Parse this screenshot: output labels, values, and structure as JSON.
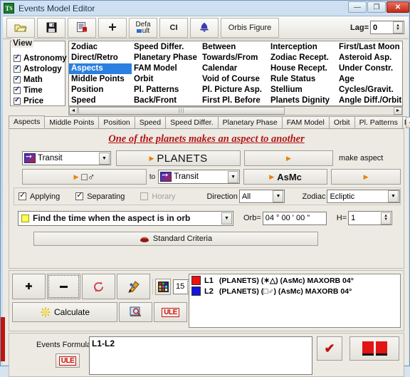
{
  "window": {
    "title": "Events Model Editor",
    "icon": "timing-solution-icon",
    "minimize": "—",
    "maximize": "❐",
    "close": "✕"
  },
  "toolbar": {
    "open": "folder-open-icon",
    "save": "floppy-save-icon",
    "save_as": "save-report-icon",
    "move": "move-cross-icon",
    "default_line1": "Defa",
    "default_line2": "ult",
    "ci": "CI",
    "bell": "bell-icon",
    "orbis_figure": "Orbis Figure",
    "lag_label": "Lag=",
    "lag_value": "0"
  },
  "view_panel": {
    "title": "View",
    "checkboxes": [
      {
        "label": "Astronomy",
        "checked": true
      },
      {
        "label": "Astrology",
        "checked": true
      },
      {
        "label": "Math",
        "checked": true
      },
      {
        "label": "Time",
        "checked": true
      },
      {
        "label": "Price",
        "checked": true
      }
    ],
    "columns": [
      {
        "items": [
          {
            "label": "Zodiac",
            "selected": false
          },
          {
            "label": "Direct/Retro",
            "selected": false
          },
          {
            "label": "Aspects",
            "selected": true
          },
          {
            "label": "Middle Points",
            "selected": false
          },
          {
            "label": "Position",
            "selected": false
          },
          {
            "label": "Speed",
            "selected": false
          }
        ]
      },
      {
        "items": [
          {
            "label": "Speed Differ.",
            "selected": false
          },
          {
            "label": "Planetary Phase",
            "selected": false
          },
          {
            "label": "FAM Model",
            "selected": false
          },
          {
            "label": "Orbit",
            "selected": false
          },
          {
            "label": "Pl. Patterns",
            "selected": false
          },
          {
            "label": "Back/Front",
            "selected": false
          }
        ]
      },
      {
        "items": [
          {
            "label": "Between",
            "selected": false
          },
          {
            "label": "Towards/From",
            "selected": false
          },
          {
            "label": "Calendar",
            "selected": false
          },
          {
            "label": "Void of Course",
            "selected": false
          },
          {
            "label": "Pl. Picture Asp.",
            "selected": false
          },
          {
            "label": "First Pl. Before",
            "selected": false
          }
        ]
      },
      {
        "items": [
          {
            "label": "Interception",
            "selected": false
          },
          {
            "label": "Zodiac Recept.",
            "selected": false
          },
          {
            "label": "House Recept.",
            "selected": false
          },
          {
            "label": "Rule Status",
            "selected": false
          },
          {
            "label": "Stellium",
            "selected": false
          },
          {
            "label": "Planets Dignity",
            "selected": false
          }
        ]
      },
      {
        "items": [
          {
            "label": "First/Last Moon A.N.",
            "selected": false
          },
          {
            "label": "Asteroid Asp.",
            "selected": false
          },
          {
            "label": "Under Constr.",
            "selected": false
          },
          {
            "label": "Age",
            "selected": false
          },
          {
            "label": "Cycles/Gravit.",
            "selected": false
          },
          {
            "label": "Angle Diff./Orbit",
            "selected": false
          }
        ]
      }
    ],
    "scroll_left": "◄",
    "scroll_right": "►",
    "thumb_grip": "|||"
  },
  "tabs": {
    "items": [
      {
        "label": "Aspects",
        "active": true
      },
      {
        "label": "Middle Points",
        "active": false
      },
      {
        "label": "Position",
        "active": false
      },
      {
        "label": "Speed",
        "active": false
      },
      {
        "label": "Speed Differ.",
        "active": false
      },
      {
        "label": "Planetary Phase",
        "active": false
      },
      {
        "label": "FAM Model",
        "active": false
      },
      {
        "label": "Orbit",
        "active": false
      },
      {
        "label": "Pl. Patterns",
        "active": false
      },
      {
        "label": "E",
        "active": false
      }
    ],
    "prev": "◄",
    "next": "►"
  },
  "aspects": {
    "headline": "One of the planets makes an aspect to another",
    "row1": {
      "source_dropdown": "Transit",
      "planets_button": "PLANETS",
      "empty_button": "",
      "make_aspect_label": "make aspect"
    },
    "row2": {
      "aspect_glyphs": "□♂",
      "to_label": "to",
      "target_dropdown": "Transit",
      "asmc_button": "AsMc",
      "empty_button": ""
    },
    "row3": {
      "applying_label": "Applying",
      "applying_checked": true,
      "separating_label": "Separating",
      "separating_checked": true,
      "horary_label": "Horary",
      "horary_checked": false,
      "horary_disabled": true,
      "direction_label": "Direction",
      "direction_value": "All",
      "zodiac_label": "Zodiac",
      "zodiac_value": "Ecliptic"
    },
    "row4": {
      "condition": "Find the time when the aspect is in orb",
      "orb_label": "Orb=",
      "orb_value": "04 ° 00 ' 00 \"",
      "h_label": "H=",
      "h_value": "1"
    },
    "standard_criteria": "Standard Criteria"
  },
  "calc": {
    "add": "plus-icon",
    "remove": "minus-icon",
    "refresh": "refresh-icon",
    "edit": "pencil-edit-icon",
    "palette": "color-palette-icon",
    "count": "15",
    "calculate": "Calculate",
    "preview": "preview-icon",
    "ule": "ULE",
    "lines": [
      {
        "name": "L1",
        "color": "#ee1111",
        "text": "(PLANETS) (✶△) (AsMc)  MAXORB 04°"
      },
      {
        "name": "L2",
        "color": "#1414dd",
        "text": "(PLANETS) (□♂) (AsMc)  MAXORB 04°"
      }
    ]
  },
  "formula": {
    "label": "Events Formula",
    "ule": "ULE",
    "value": "L1-L2",
    "check": "✔",
    "books": "books-icon"
  }
}
